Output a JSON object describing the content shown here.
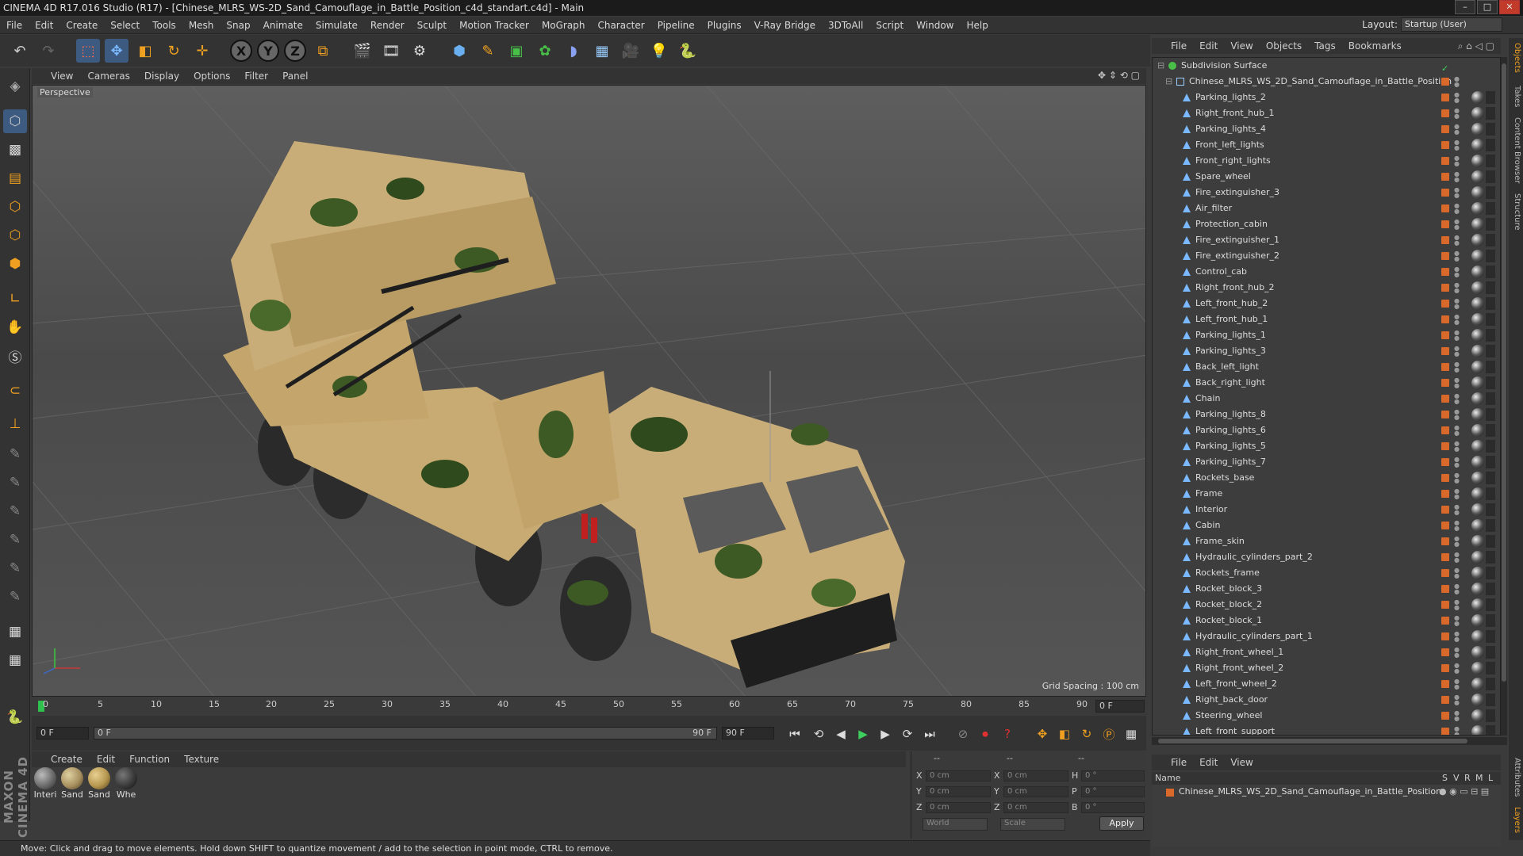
{
  "window": {
    "title": "CINEMA 4D R17.016 Studio (R17) - [Chinese_MLRS_WS-2D_Sand_Camouflage_in_Battle_Position_c4d_standart.c4d] - Main",
    "controls": [
      "–",
      "□",
      "✕"
    ]
  },
  "menu": [
    "File",
    "Edit",
    "Create",
    "Select",
    "Tools",
    "Mesh",
    "Snap",
    "Animate",
    "Simulate",
    "Render",
    "Sculpt",
    "Motion Tracker",
    "MoGraph",
    "Character",
    "Pipeline",
    "Plugins",
    "V-Ray Bridge",
    "3DToAll",
    "Script",
    "Window",
    "Help"
  ],
  "layout": {
    "label": "Layout:",
    "value": "Startup (User)"
  },
  "toolbar": {
    "icons": [
      "undo-icon",
      "redo-icon",
      "live-selection-icon",
      "move-icon",
      "scale-icon",
      "rotate-icon",
      "recent-tool-icon",
      "x-axis-icon",
      "y-axis-icon",
      "z-axis-icon",
      "coordinate-system-icon",
      "render-view-icon",
      "render-picture-viewer-icon",
      "edit-render-settings-icon",
      "cube-icon",
      "pen-icon",
      "subdivision-icon",
      "cloner-icon",
      "deformer-icon",
      "floor-icon",
      "camera-icon",
      "light-icon",
      "python-icon"
    ],
    "axes": [
      "X",
      "Y",
      "Z"
    ]
  },
  "viewport": {
    "menu": [
      "View",
      "Cameras",
      "Display",
      "Options",
      "Filter",
      "Panel"
    ],
    "label": "Perspective",
    "grid_spacing": "Grid Spacing : 100 cm"
  },
  "timeline": {
    "ticks": [
      "0",
      "5",
      "10",
      "15",
      "20",
      "25",
      "30",
      "35",
      "40",
      "45",
      "50",
      "55",
      "60",
      "65",
      "70",
      "75",
      "80",
      "85",
      "90"
    ],
    "current_frame": "0 F",
    "start": "0 F",
    "range_start": "0 F",
    "range_end": "90 F",
    "end": "90 F"
  },
  "materials": {
    "menu": [
      "Create",
      "Edit",
      "Function",
      "Texture"
    ],
    "items": [
      {
        "name": "Interi",
        "color": "#7a7a7a"
      },
      {
        "name": "Sand",
        "color": "#a89060"
      },
      {
        "name": "Sand",
        "color": "#b5964f"
      },
      {
        "name": "Whe",
        "color": "#3a3a3a"
      }
    ]
  },
  "coords": {
    "header": [
      "--",
      "--",
      "--"
    ],
    "rows": [
      {
        "a": "X",
        "av": "0 cm",
        "b": "X",
        "bv": "0 cm",
        "c": "H",
        "cv": "0 °"
      },
      {
        "a": "Y",
        "av": "0 cm",
        "b": "Y",
        "bv": "0 cm",
        "c": "P",
        "cv": "0 °"
      },
      {
        "a": "Z",
        "av": "0 cm",
        "b": "Z",
        "bv": "0 cm",
        "c": "B",
        "cv": "0 °"
      }
    ],
    "mode1": "World",
    "mode2": "Scale",
    "apply": "Apply"
  },
  "status": "Move: Click and drag to move elements. Hold down SHIFT to quantize movement / add to the selection in point mode, CTRL to remove.",
  "object_manager": {
    "menu": [
      "File",
      "Edit",
      "View",
      "Objects",
      "Tags",
      "Bookmarks"
    ],
    "root": "Subdivision Surface",
    "group": "Chinese_MLRS_WS_2D_Sand_Camouflage_in_Battle_Position",
    "objects": [
      "Parking_lights_2",
      "Right_front_hub_1",
      "Parking_lights_4",
      "Front_left_lights",
      "Front_right_lights",
      "Spare_wheel",
      "Fire_extinguisher_3",
      "Air_filter",
      "Protection_cabin",
      "Fire_extinguisher_1",
      "Fire_extinguisher_2",
      "Control_cab",
      "Right_front_hub_2",
      "Left_front_hub_2",
      "Left_front_hub_1",
      "Parking_lights_1",
      "Parking_lights_3",
      "Back_left_light",
      "Back_right_light",
      "Chain",
      "Parking_lights_8",
      "Parking_lights_6",
      "Parking_lights_5",
      "Parking_lights_7",
      "Rockets_base",
      "Frame",
      "Interior",
      "Cabin",
      "Frame_skin",
      "Hydraulic_cylinders_part_2",
      "Rockets_frame",
      "Rocket_block_3",
      "Rocket_block_2",
      "Rocket_block_1",
      "Hydraulic_cylinders_part_1",
      "Right_front_wheel_1",
      "Right_front_wheel_2",
      "Left_front_wheel_2",
      "Right_back_door",
      "Steering_wheel",
      "Left_front_support"
    ]
  },
  "layers": {
    "menu": [
      "File",
      "Edit",
      "View"
    ],
    "columns": {
      "name": "Name",
      "flags": [
        "S",
        "V",
        "R",
        "M",
        "L"
      ]
    },
    "row": "Chinese_MLRS_WS_2D_Sand_Camouflage_in_Battle_Position"
  },
  "side_tabs": [
    "Objects",
    "Takes",
    "Content Browser",
    "Structure",
    "Attributes",
    "Layers"
  ],
  "colors": {
    "accent_orange": "#d9682b",
    "sand": "#c9ad78",
    "camo_green": "#3d5a24"
  }
}
